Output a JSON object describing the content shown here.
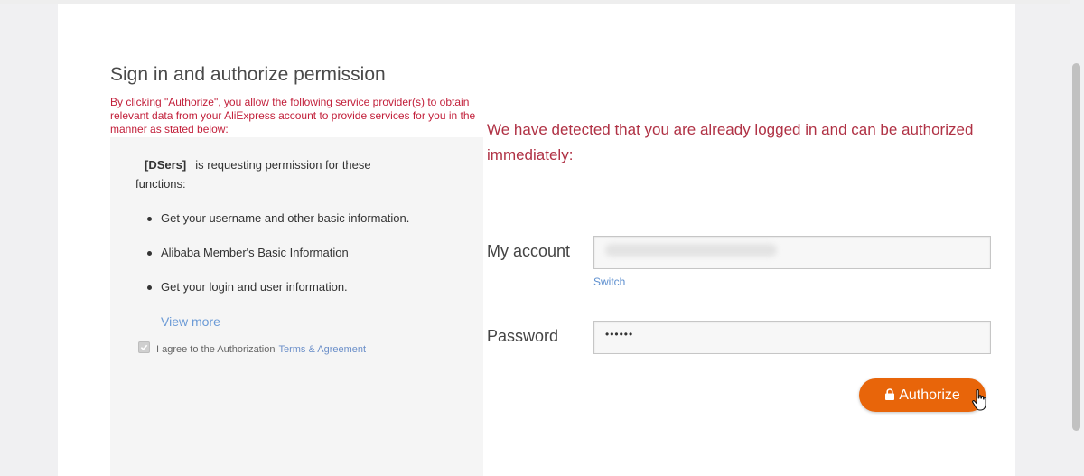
{
  "page": {
    "title": "Sign in and authorize permission",
    "notice": "By clicking \"Authorize\", you allow the following service provider(s) to obtain relevant data from your AliExpress account to provide services for you in the manner as stated below:"
  },
  "permissions": {
    "app_name": "[DSers]",
    "request_text": "is requesting permission for these functions:",
    "items": [
      "Get your username and other basic information.",
      "Alibaba Member's Basic Information",
      "Get your login and user information."
    ],
    "view_more": "View more",
    "agree_text": "I agree to the Authorization",
    "agree_link": "Terms & Agreement",
    "agree_checked": true
  },
  "login": {
    "detected_message": "We have detected that you are already logged in and can be authorized immediately:",
    "account_label": "My account",
    "switch_label": "Switch",
    "password_label": "Password",
    "password_value": "••••••",
    "authorize_label": "Authorize"
  },
  "colors": {
    "accent_red": "#c21f3a",
    "button_orange": "#e8650a",
    "link_blue": "#6b9ad6"
  },
  "icons": {
    "lock": "lock-icon",
    "checkbox": "checkmark-icon",
    "cursor": "hand-pointer-icon"
  }
}
